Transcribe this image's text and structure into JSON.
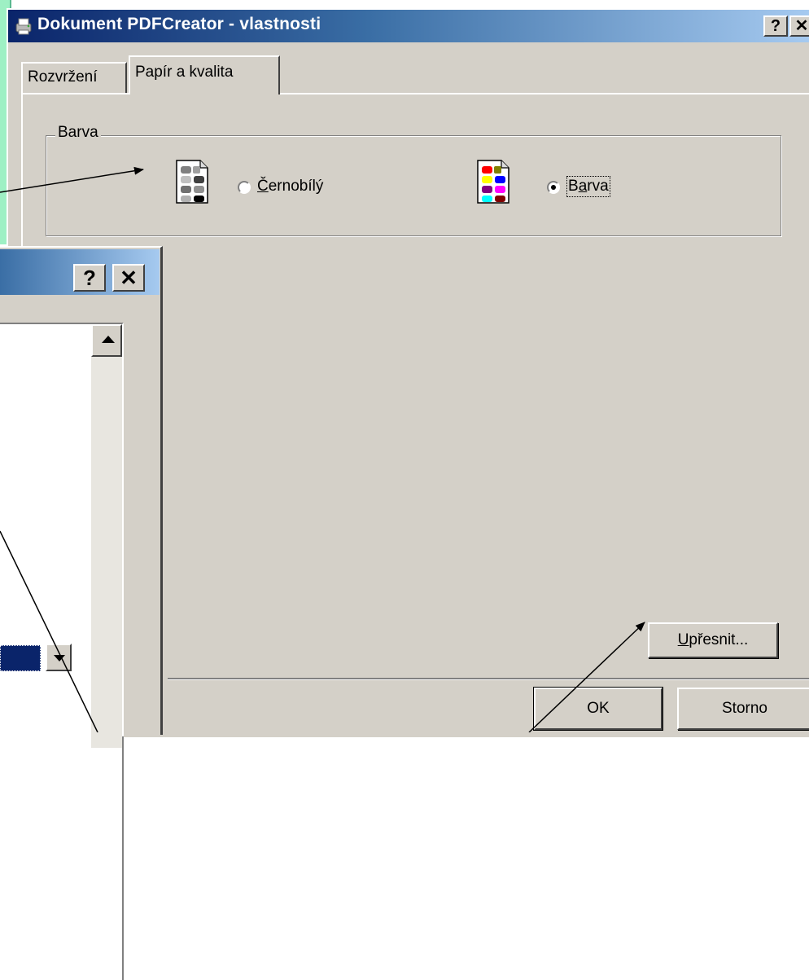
{
  "window": {
    "title": "Dokument PDFCreator - vlastnosti",
    "help_label": "?",
    "close_label": "✕"
  },
  "tabs": [
    {
      "label": "Rozvržení",
      "active": false
    },
    {
      "label": "Papír a kvalita",
      "active": true
    }
  ],
  "color_group": {
    "legend": "Barva",
    "options": [
      {
        "label_first": "Č",
        "label_rest": "ernobílý",
        "selected": false
      },
      {
        "label_first": "B",
        "label_mid": "a",
        "label_rest": "rva",
        "selected": true
      }
    ]
  },
  "buttons": {
    "advanced_first": "U",
    "advanced_rest": "přesnit...",
    "ok": "OK",
    "cancel": "Storno"
  },
  "sub_window": {
    "help_label": "?",
    "close_label": "✕"
  },
  "colors": {
    "titlebar_start": "#0a246a",
    "titlebar_end": "#a6caf0",
    "dialog_face": "#d4d0c8",
    "desktop_strip": "#9ef0c4"
  }
}
